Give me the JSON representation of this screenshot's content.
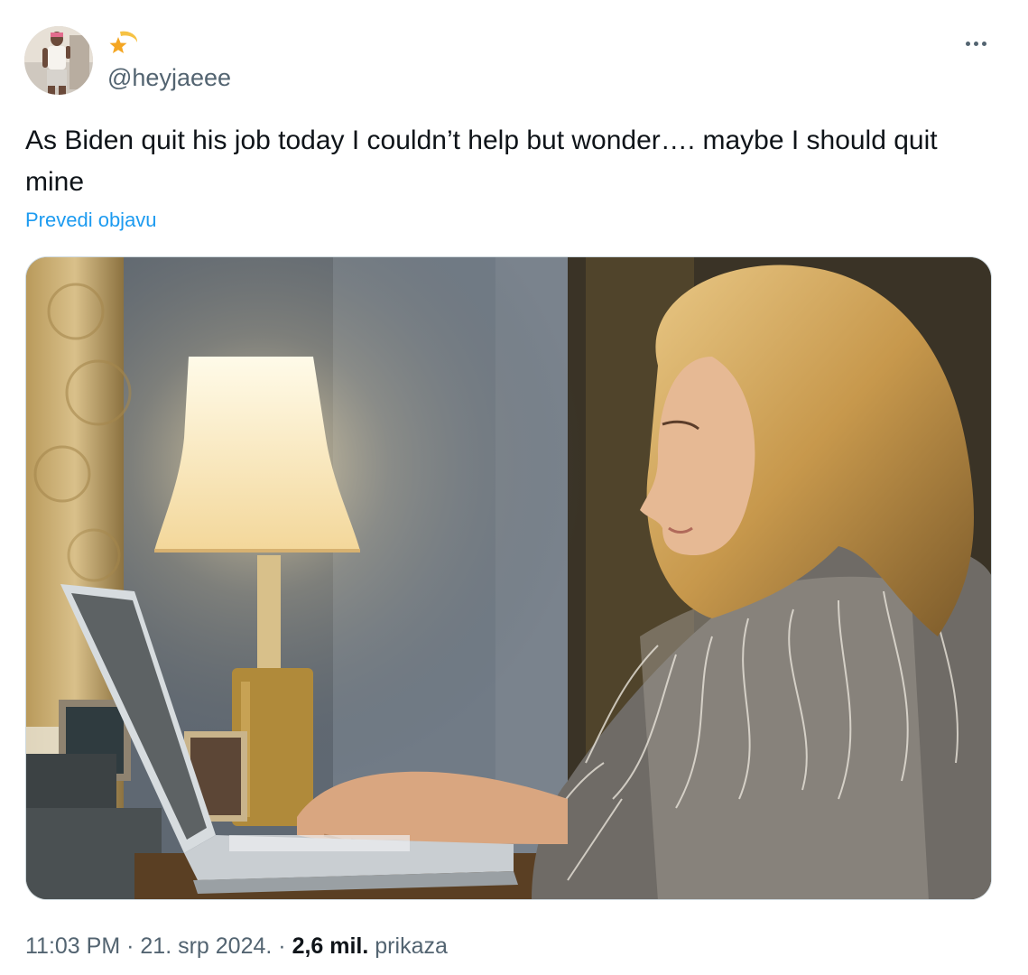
{
  "tweet": {
    "handle": "@heyjaeee",
    "text": "As Biden quit his job today I couldn’t help but wonder…. maybe I should quit mine",
    "translate_label": "Prevedi objavu",
    "time": "11:03 PM",
    "separator": "·",
    "date": "21. srp 2024.",
    "views_count": "2,6 mil.",
    "views_label": "prikaza"
  },
  "icons": {
    "author_emoji": "shooting-star-icon",
    "more": "more-horizontal-icon"
  },
  "colors": {
    "text_primary": "#0f1419",
    "text_secondary": "#536471",
    "link": "#1d9bf0",
    "border": "#cfd9de"
  }
}
